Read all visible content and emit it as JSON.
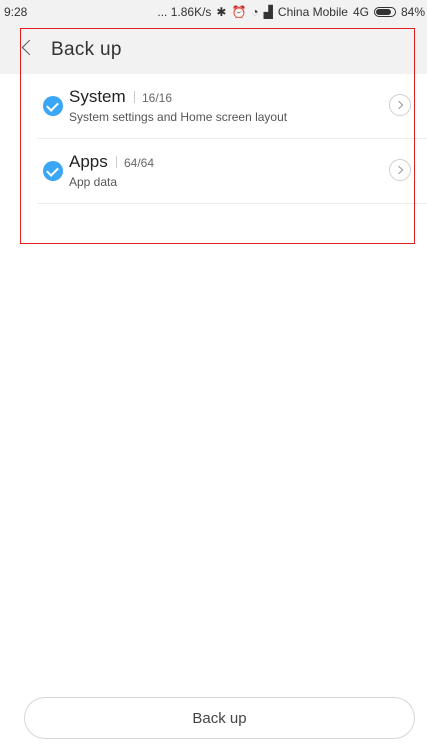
{
  "status_bar": {
    "time": "9:28",
    "speed": "... 1.86K/s",
    "carrier": "China Mobile",
    "network": "4G",
    "battery_percent": "84%",
    "battery_level": 0.84
  },
  "header": {
    "title": "Back up"
  },
  "items": [
    {
      "title": "System",
      "count": "16/16",
      "description": "System settings and Home screen layout",
      "checked": true
    },
    {
      "title": "Apps",
      "count": "64/64",
      "description": "App data",
      "checked": true
    }
  ],
  "footer": {
    "button_label": "Back up"
  },
  "colors": {
    "accent": "#3aa6f5",
    "annotation": "#e02020"
  }
}
